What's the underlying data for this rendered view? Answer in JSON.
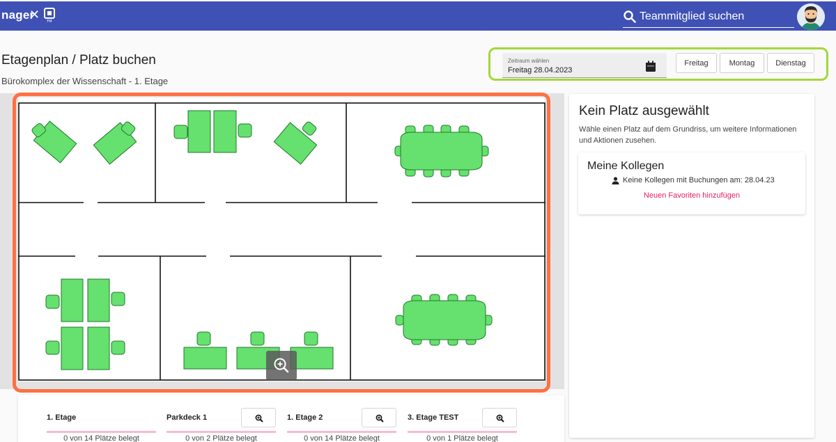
{
  "header": {
    "brand": "nager",
    "close_symbol": "✕",
    "logo_caption": "FM",
    "search_placeholder": "Teammitglied suchen"
  },
  "page": {
    "title": "Etagenplan / Platz buchen",
    "subtitle": "Bürokomplex der Wissenschaft - 1. Etage"
  },
  "toolbar": {
    "date_label": "Zeitraum wählen",
    "date_value": "Freitag 28.04.2023",
    "days": [
      "Freitag",
      "Montag",
      "Dienstag"
    ]
  },
  "side_panel": {
    "title": "Kein Platz ausgewählt",
    "description": "Wähle einen Platz auf dem Grundriss, um weitere Informationen und Aktionen zusehen.",
    "colleagues": {
      "title": "Meine Kollegen",
      "info": "Keine Kollegen mit Buchungen am: 28.04.23",
      "link": "Neuen Favoriten hinzufügen"
    }
  },
  "floors": [
    {
      "name": "1. Etage",
      "count": "0 von 14 Plätze belegt",
      "has_zoom": false
    },
    {
      "name": "Parkdeck 1",
      "count": "0 von 2 Plätze belegt",
      "has_zoom": true
    },
    {
      "name": "1. Etage 2",
      "count": "0 von 14 Plätze belegt",
      "has_zoom": true
    },
    {
      "name": "3. Etage TEST",
      "count": "0 von 1 Plätze belegt",
      "has_zoom": true
    }
  ],
  "colors": {
    "header": "#3f51b5",
    "highlight_toolbar": "#a4d63b",
    "highlight_plan": "#ff7043",
    "desk": "#66e06e",
    "link": "#e91e63"
  }
}
